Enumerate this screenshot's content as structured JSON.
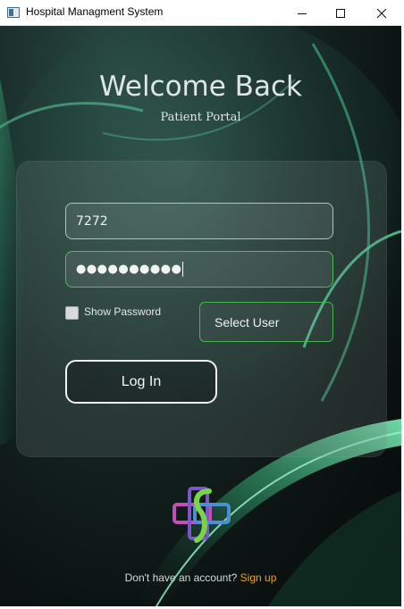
{
  "window": {
    "title": "Hospital Managment System",
    "minimize_icon": "minimize-icon",
    "maximize_icon": "maximize-icon",
    "close_icon": "close-icon"
  },
  "header": {
    "title": "Welcome Back",
    "subtitle": "Patient Portal"
  },
  "form": {
    "username_value": "7272",
    "password_masked": "●●●●●●●●●●",
    "show_password_label": "Show Password",
    "show_password_checked": false,
    "select_user_label": "Select User",
    "login_label": "Log In"
  },
  "footer": {
    "question": "Don't have an account?",
    "signup_label": "Sign up"
  },
  "colors": {
    "accent_green": "#45b352",
    "link_orange": "#f0a21c",
    "background_dark": "#0b1211"
  },
  "icons": {
    "app": "app-window-icon",
    "logo": "medical-cross-logo-icon"
  }
}
